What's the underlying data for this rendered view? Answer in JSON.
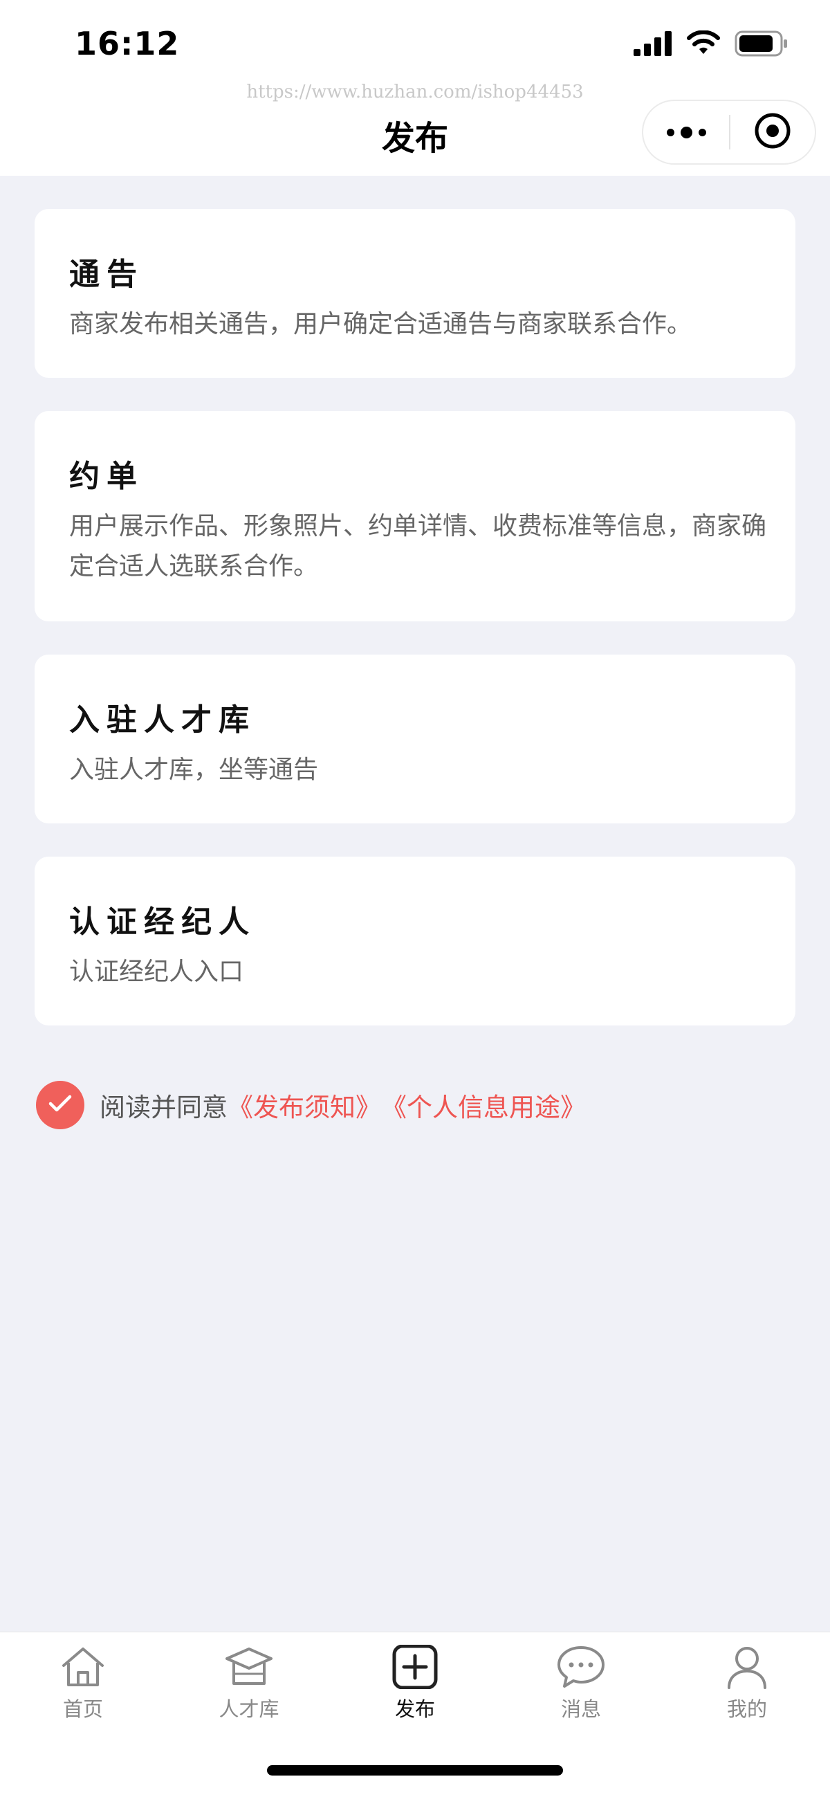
{
  "status_bar": {
    "time": "16:12"
  },
  "watermark": "https://www.huzhan.com/ishop44453",
  "header": {
    "title": "发布"
  },
  "cards": [
    {
      "title": "通告",
      "description": "商家发布相关通告，用户确定合适通告与商家联系合作。"
    },
    {
      "title": "约单",
      "description": "用户展示作品、形象照片、约单详情、收费标准等信息，商家确定合适人选联系合作。"
    },
    {
      "title": "入驻人才库",
      "description": "入驻人才库，坐等通告"
    },
    {
      "title": "认证经纪人",
      "description": "认证经纪人入口"
    }
  ],
  "agreement": {
    "checked": true,
    "text": "阅读并同意",
    "link_notice": "《发布须知》",
    "link_privacy": "《个人信息用途》"
  },
  "tabbar": {
    "items": [
      {
        "label": "首页",
        "icon": "home-icon"
      },
      {
        "label": "人才库",
        "icon": "graduation-cap-icon"
      },
      {
        "label": "发布",
        "icon": "plus-square-icon",
        "active": true
      },
      {
        "label": "消息",
        "icon": "chat-bubble-icon"
      },
      {
        "label": "我的",
        "icon": "user-icon"
      }
    ]
  },
  "colors": {
    "accent": "#f0605b",
    "background": "#f0f1f7",
    "card": "#ffffff"
  }
}
